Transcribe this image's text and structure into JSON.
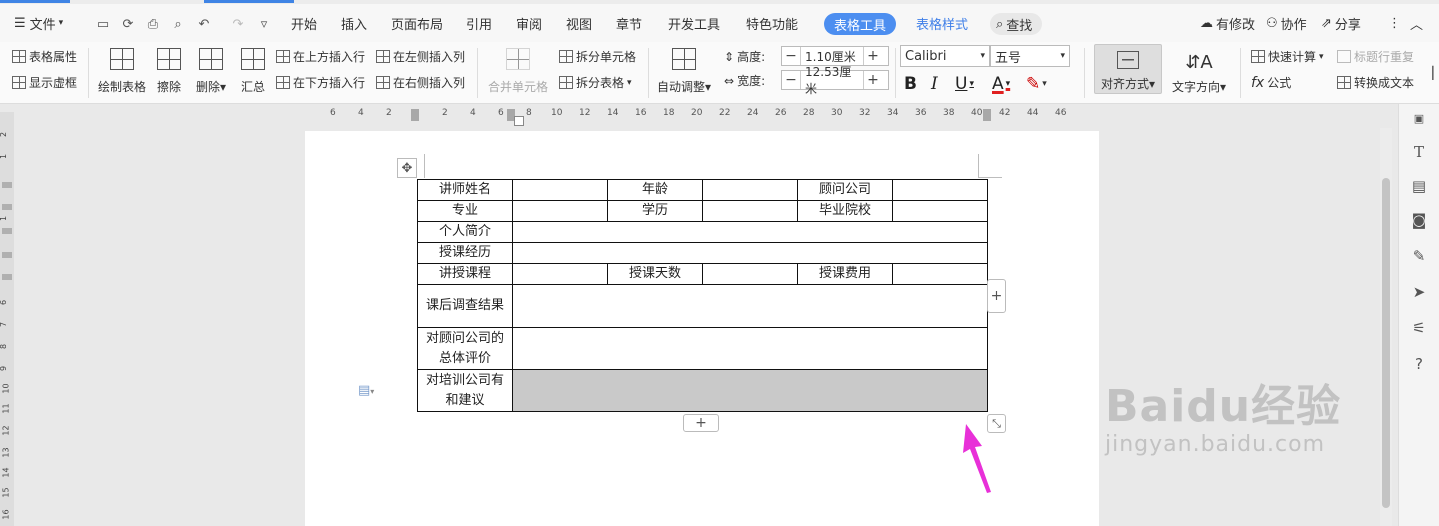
{
  "menubar": {
    "file_label": "文件",
    "tabs": [
      "开始",
      "插入",
      "页面布局",
      "引用",
      "审阅",
      "视图",
      "章节",
      "开发工具",
      "特色功能"
    ],
    "active_tab": "表格工具",
    "extra_tab": "表格样式",
    "search_label": "查找",
    "right": {
      "modified": "有修改",
      "collab": "协作",
      "share": "分享"
    }
  },
  "ribbon": {
    "table_props": "表格属性",
    "show_gridlines": "显示虚框",
    "draw_table": "绘制表格",
    "erase": "擦除",
    "delete": "删除",
    "summary": "汇总",
    "insert_above": "在上方插入行",
    "insert_below": "在下方插入行",
    "insert_left": "在左侧插入列",
    "insert_right": "在右侧插入列",
    "merge_cells": "合并单元格",
    "split_cells": "拆分单元格",
    "split_table": "拆分表格",
    "auto_fit": "自动调整",
    "height_label": "高度:",
    "height_value": "1.10厘米",
    "width_label": "宽度:",
    "width_value": "12.53厘米",
    "font_name": "Calibri",
    "font_size": "五号",
    "align": "对齐方式",
    "text_dir": "文字方向",
    "quick_calc": "快速计算",
    "repeat_header": "标题行重复",
    "formula": "公式",
    "to_text": "转换成文本"
  },
  "ruler": {
    "numbers": [
      "6",
      "4",
      "2",
      "2",
      "4",
      "6",
      "8",
      "10",
      "12",
      "14",
      "16",
      "18",
      "20",
      "22",
      "24",
      "26",
      "28",
      "30",
      "32",
      "34",
      "36",
      "38",
      "40",
      "42",
      "44",
      "46"
    ]
  },
  "vruler": {
    "numbers": [
      "2",
      "1",
      "1",
      "6",
      "7",
      "8",
      "9",
      "10",
      "11",
      "12",
      "13",
      "14",
      "15",
      "16"
    ]
  },
  "table": {
    "rows": [
      [
        "讲师姓名",
        "",
        "年龄",
        "",
        "顾问公司",
        ""
      ],
      [
        "专业",
        "",
        "学历",
        "",
        "毕业院校",
        ""
      ],
      [
        "个人简介",
        ""
      ],
      [
        "授课经历",
        ""
      ],
      [
        "讲授课程",
        "",
        "授课天数",
        "",
        "授课费用",
        ""
      ],
      [
        "课后调查结果",
        ""
      ],
      [
        "对顾问公司的总体评价",
        ""
      ],
      [
        "对培训公司有和建议",
        ""
      ]
    ]
  },
  "watermark": {
    "brand": "Baidu经验",
    "url": "jingyan.baidu.com"
  },
  "colors": {
    "accent": "#4c8ef0",
    "arrow": "#e830d8",
    "selection": "#c9c9c9"
  }
}
